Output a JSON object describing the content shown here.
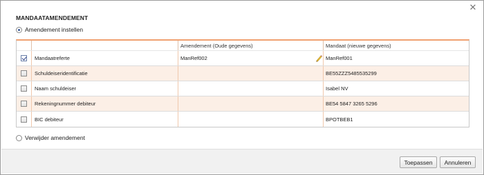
{
  "dialog": {
    "title": "MANDAATAMENDEMENT",
    "close_icon": "close-icon"
  },
  "options": {
    "set_amendment": {
      "label": "Amendement instellen",
      "selected": true
    },
    "remove_amendment": {
      "label": "Verwijder amendement",
      "selected": false
    }
  },
  "table": {
    "headers": {
      "old": "Amendement (Oude gegevens)",
      "new": "Mandaat (nieuwe gegevens)"
    },
    "rows": [
      {
        "checked": true,
        "field": "Mandaatreferte",
        "old": "ManRef002",
        "new": "ManRef001",
        "editable_icon": "pencil-icon"
      },
      {
        "checked": false,
        "field": "Schuldeiseridentificatie",
        "old": "",
        "new": "BE55ZZZ5485535299"
      },
      {
        "checked": false,
        "field": "Naam schuldeiser",
        "old": "",
        "new": "Isabel NV"
      },
      {
        "checked": false,
        "field": "Rekeningnummer debiteur",
        "old": "",
        "new": "BE54 5847 3265 5296"
      },
      {
        "checked": false,
        "field": "BIC debiteur",
        "old": "",
        "new": "BPOTBEB1"
      }
    ]
  },
  "footer": {
    "apply_label": "Toepassen",
    "cancel_label": "Annuleren"
  },
  "colors": {
    "accent_border": "#f0a070",
    "alt_row": "#fcefe6",
    "radio_dot": "#3a5a9a"
  }
}
